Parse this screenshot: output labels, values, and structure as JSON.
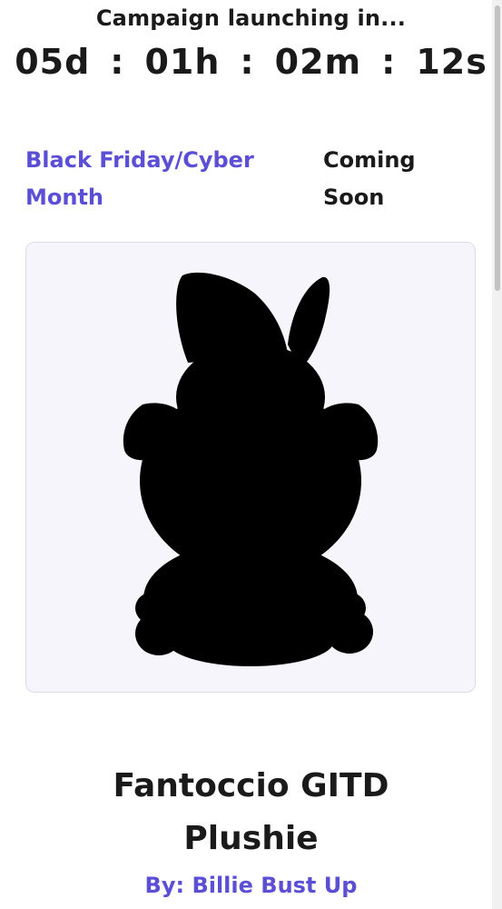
{
  "countdown": {
    "title": "Campaign launching in...",
    "days": "05d",
    "hours": "01h",
    "minutes": "02m",
    "seconds": "12s",
    "separator": ":"
  },
  "campaign": {
    "name": "Black Friday/Cyber Month",
    "status": "Coming Soon"
  },
  "product": {
    "image": "plushie-silhouette",
    "title": "Fantoccio GITD Plushie",
    "byline": "By: Billie Bust Up"
  },
  "colors": {
    "accent": "#5b4fd6",
    "text": "#1a1a1a",
    "card_background": "#f6f5fc"
  }
}
